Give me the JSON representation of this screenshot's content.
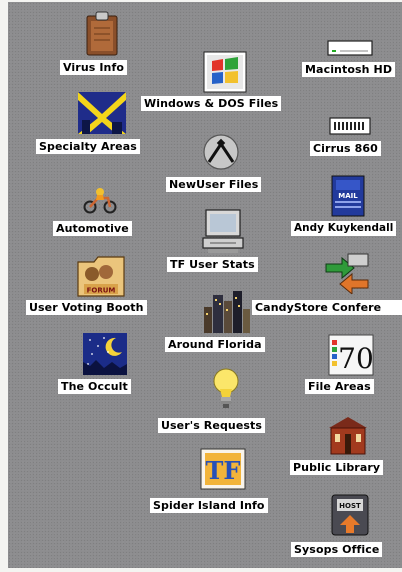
{
  "desktop": {
    "icons": [
      {
        "label": "Virus Info",
        "icon": "clipboard-icon"
      },
      {
        "label": "Macintosh HD",
        "icon": "hard-disk-icon"
      },
      {
        "label": "Windows & DOS Files",
        "icon": "windows-logo-icon"
      },
      {
        "label": "Specialty Areas",
        "icon": "specialty-folder-icon"
      },
      {
        "label": "Cirrus 860",
        "icon": "cirrus-drive-icon"
      },
      {
        "label": "NewUser Files",
        "icon": "newuser-pen-icon"
      },
      {
        "label": "Automotive",
        "icon": "motorcycle-icon"
      },
      {
        "label": "Andy Kuykendall",
        "icon": "mail-icon"
      },
      {
        "label": "TF User Stats",
        "icon": "computer-icon"
      },
      {
        "label": "User Voting Booth",
        "icon": "forum-folder-icon"
      },
      {
        "label": "CandyStore Confere",
        "icon": "candystore-arrows-icon"
      },
      {
        "label": "Around Florida",
        "icon": "city-skyline-icon"
      },
      {
        "label": "The Occult",
        "icon": "night-moon-icon"
      },
      {
        "label": "File Areas",
        "icon": "seventy-number-icon"
      },
      {
        "label": "User's Requests",
        "icon": "lightbulb-icon"
      },
      {
        "label": "Public Library",
        "icon": "library-building-icon"
      },
      {
        "label": "Spider Island Info",
        "icon": "tf-logo-icon"
      },
      {
        "label": "Sysops Office",
        "icon": "host-machine-icon"
      }
    ],
    "icon_text": {
      "mail": "MAIL",
      "forum": "FORUM",
      "host": "HOST",
      "seventy": "70",
      "tf": "TF"
    }
  }
}
